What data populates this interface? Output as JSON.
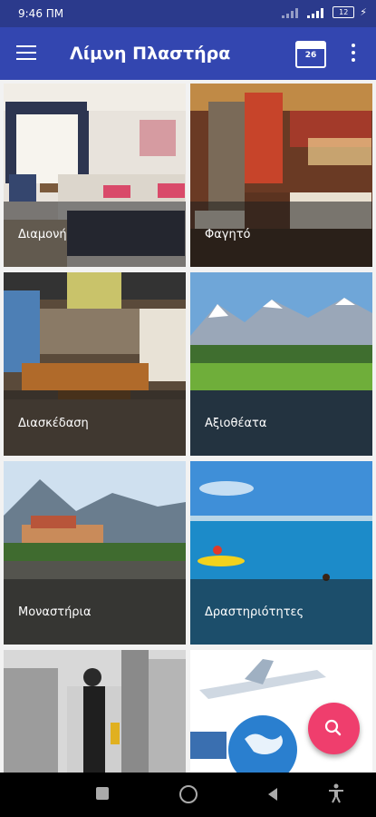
{
  "status_bar": {
    "time": "9:46 ΠΜ",
    "battery": "12"
  },
  "app_bar": {
    "title": "Λίμνη Πλαστήρα",
    "calendar_day": "26"
  },
  "tiles": [
    {
      "label": "Διαμονή",
      "image": "hotel-room"
    },
    {
      "label": "Φαγητό",
      "image": "restaurant"
    },
    {
      "label": "Διασκέδαση",
      "image": "bar-lounge"
    },
    {
      "label": "Αξιοθέατα",
      "image": "lake-mountains"
    },
    {
      "label": "Μοναστήρια",
      "image": "monastery-cliffs"
    },
    {
      "label": "Δραστηριότητες",
      "image": "kayak-sea"
    },
    {
      "label": "",
      "image": "city-shopping"
    },
    {
      "label": "",
      "image": "airplane-globe"
    }
  ],
  "fab": {
    "icon": "search-icon"
  },
  "nav_bar": {
    "icons": [
      "recents-icon",
      "home-icon",
      "back-icon",
      "accessibility-icon"
    ]
  },
  "colors": {
    "status_bar": "#2b3a8c",
    "app_bar": "#3346b0",
    "fab": "#ef3e6d"
  }
}
